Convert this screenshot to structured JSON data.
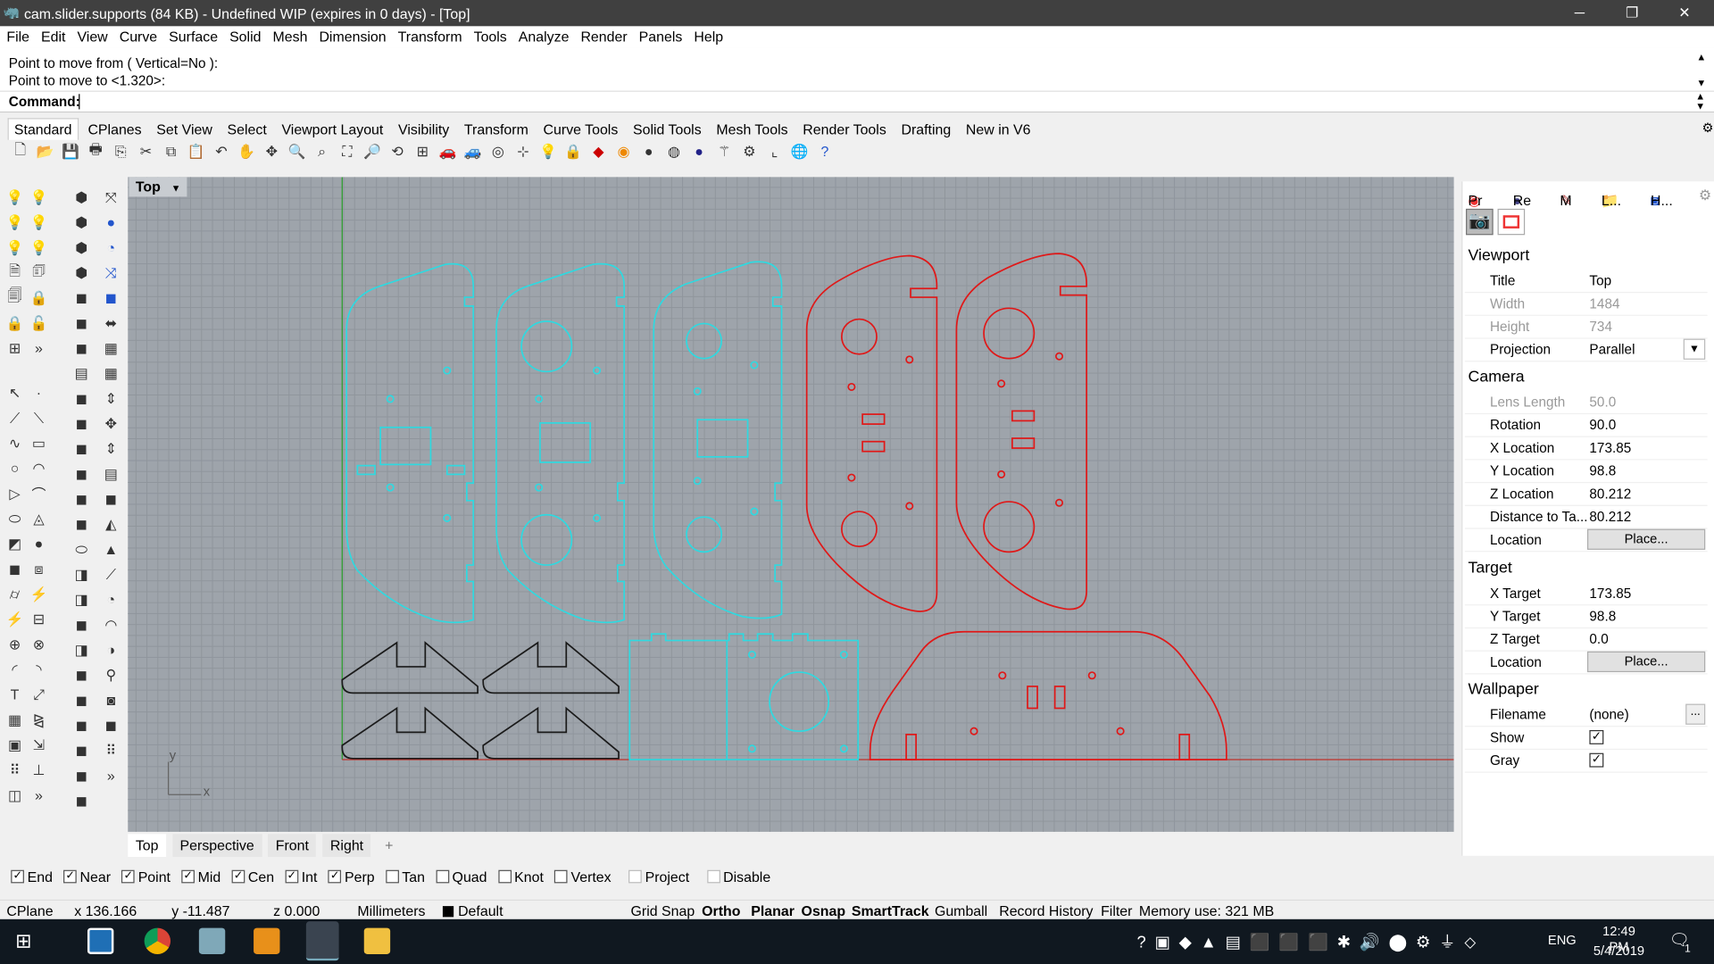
{
  "title": "cam.slider.supports (84 KB) - Undefined WIP (expires in 0 days) - [Top]",
  "menu": [
    "File",
    "Edit",
    "View",
    "Curve",
    "Surface",
    "Solid",
    "Mesh",
    "Dimension",
    "Transform",
    "Tools",
    "Analyze",
    "Render",
    "Panels",
    "Help"
  ],
  "command": {
    "history": [
      "Point to move from ( Vertical=No ):",
      "Point to move to <1.320>:"
    ],
    "prompt": "Command:"
  },
  "toolbar_tabs": [
    "Standard",
    "CPlanes",
    "Set View",
    "Select",
    "Viewport Layout",
    "Visibility",
    "Transform",
    "Curve Tools",
    "Solid Tools",
    "Mesh Tools",
    "Render Tools",
    "Drafting",
    "New in V6"
  ],
  "viewport": {
    "label": "Top",
    "axis_x": "x",
    "axis_y": "y"
  },
  "viewport_tabs": [
    "Top",
    "Perspective",
    "Front",
    "Right"
  ],
  "osnap": [
    {
      "label": "End",
      "checked": true
    },
    {
      "label": "Near",
      "checked": true
    },
    {
      "label": "Point",
      "checked": true
    },
    {
      "label": "Mid",
      "checked": true
    },
    {
      "label": "Cen",
      "checked": true
    },
    {
      "label": "Int",
      "checked": true
    },
    {
      "label": "Perp",
      "checked": true
    },
    {
      "label": "Tan",
      "checked": false
    },
    {
      "label": "Quad",
      "checked": false
    },
    {
      "label": "Knot",
      "checked": false
    },
    {
      "label": "Vertex",
      "checked": false
    },
    {
      "label": "Project",
      "checked": false
    },
    {
      "label": "Disable",
      "checked": false
    }
  ],
  "status": {
    "cplane": "CPlane",
    "x": "x 136.166",
    "y": "y -11.487",
    "z": "z 0.000",
    "units": "Millimeters",
    "layer": "Default",
    "toggles": [
      "Grid Snap",
      "Ortho",
      "Planar",
      "Osnap",
      "SmartTrack",
      "Gumball",
      "Record History",
      "Filter"
    ],
    "memory": "Memory use: 321 MB"
  },
  "panel": {
    "tabs": [
      "Pr",
      "Re",
      "M",
      "L...",
      "H..."
    ],
    "viewport_title": "Viewport",
    "viewport_props": [
      {
        "k": "Title",
        "v": "Top"
      },
      {
        "k": "Width",
        "v": "1484"
      },
      {
        "k": "Height",
        "v": "734"
      },
      {
        "k": "Projection",
        "v": "Parallel"
      }
    ],
    "camera_title": "Camera",
    "camera_props": [
      {
        "k": "Lens Length",
        "v": "50.0"
      },
      {
        "k": "Rotation",
        "v": "90.0"
      },
      {
        "k": "X Location",
        "v": "173.85"
      },
      {
        "k": "Y Location",
        "v": "98.8"
      },
      {
        "k": "Z Location",
        "v": "80.212"
      },
      {
        "k": "Distance to Ta...",
        "v": "80.212"
      },
      {
        "k": "Location",
        "v": "Place..."
      }
    ],
    "target_title": "Target",
    "target_props": [
      {
        "k": "X Target",
        "v": "173.85"
      },
      {
        "k": "Y Target",
        "v": "98.8"
      },
      {
        "k": "Z Target",
        "v": "0.0"
      },
      {
        "k": "Location",
        "v": "Place..."
      }
    ],
    "wallpaper_title": "Wallpaper",
    "wallpaper_props": [
      {
        "k": "Filename",
        "v": "(none)"
      },
      {
        "k": "Show",
        "v": "checked"
      },
      {
        "k": "Gray",
        "v": "checked"
      }
    ],
    "browse": "..."
  },
  "taskbar": {
    "time": "12:49 PM",
    "date": "5/4/2019",
    "lang": "ENG",
    "notif": "1"
  },
  "colors": {
    "cyan": "#2fd9e0",
    "red": "#e01818",
    "black": "#1a1a1a",
    "grid": "#9ea4ab"
  }
}
